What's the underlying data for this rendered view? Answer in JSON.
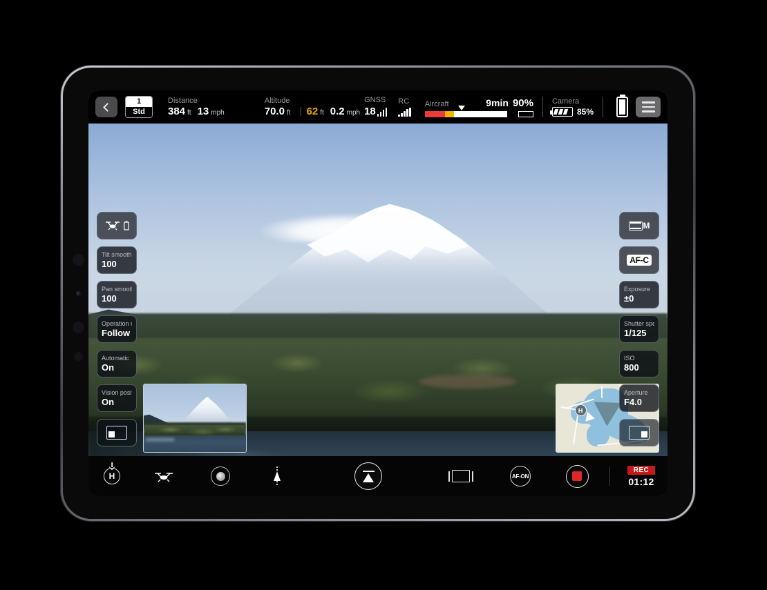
{
  "topbar": {
    "back_icon": "chevron-left-icon",
    "mode_badge": {
      "number": "1",
      "label": "Std"
    },
    "distance": {
      "label": "Distance",
      "value": "384",
      "unit": "ft",
      "speed": "13",
      "speed_unit": "mph"
    },
    "altitude": {
      "label": "Altitude",
      "value": "70.0",
      "unit": "ft",
      "rel_value": "62",
      "rel_unit": "ft",
      "vspeed": "0.2",
      "vspeed_unit": "mph",
      "rel_color": "#f0a500"
    },
    "gnss": {
      "label": "GNSS",
      "value": "18",
      "bars": 4
    },
    "rc": {
      "label": "RC",
      "bars": 5
    },
    "aircraft": {
      "label": "Aircraft",
      "time_remaining": "9min",
      "percent": "90%",
      "bar_percent": 90,
      "marker_percent": 31,
      "red_color": "#ef3b3b",
      "amber_color": "#f5b400"
    },
    "camera": {
      "label": "Camera",
      "percent": "85%"
    },
    "menu_icon": "hamburger-menu-icon"
  },
  "left_panel": [
    {
      "name": "aircraft-battery-status",
      "type": "icon"
    },
    {
      "label": "Tilt smooth",
      "value": "100"
    },
    {
      "label": "Pan smooth",
      "value": "100"
    },
    {
      "label": "Operation mode",
      "value": "Follow"
    },
    {
      "label": "Automatic",
      "value": "On"
    },
    {
      "label": "Vision position",
      "value": "On"
    }
  ],
  "left_pip_toggle": {
    "name": "pip-layout-left-button"
  },
  "right_panel": [
    {
      "label": "",
      "value": "M",
      "type": "video-mode"
    },
    {
      "label": "",
      "value": "AF-C",
      "type": "focus-mode"
    },
    {
      "label": "Exposure",
      "value": "±0"
    },
    {
      "label": "Shutter speed",
      "value": "1/125"
    },
    {
      "label": "ISO",
      "value": "800"
    },
    {
      "label": "Aperture",
      "value": "F4.0"
    }
  ],
  "right_pip_toggle": {
    "name": "pip-layout-right-button"
  },
  "map": {
    "home_label": "H"
  },
  "bottombar": {
    "rth_label": "H",
    "items": [
      {
        "name": "return-to-home-button"
      },
      {
        "name": "takeoff-landing-button"
      },
      {
        "name": "gimbal-dial-button"
      },
      {
        "name": "navigate-pointer-button"
      },
      {
        "name": "recenter-gimbal-button"
      },
      {
        "name": "aspect-ratio-button"
      },
      {
        "name": "af-on-button"
      },
      {
        "name": "record-button"
      }
    ],
    "af_on_label": "AF-ON",
    "rec_badge": "REC",
    "rec_time": "01:12"
  }
}
